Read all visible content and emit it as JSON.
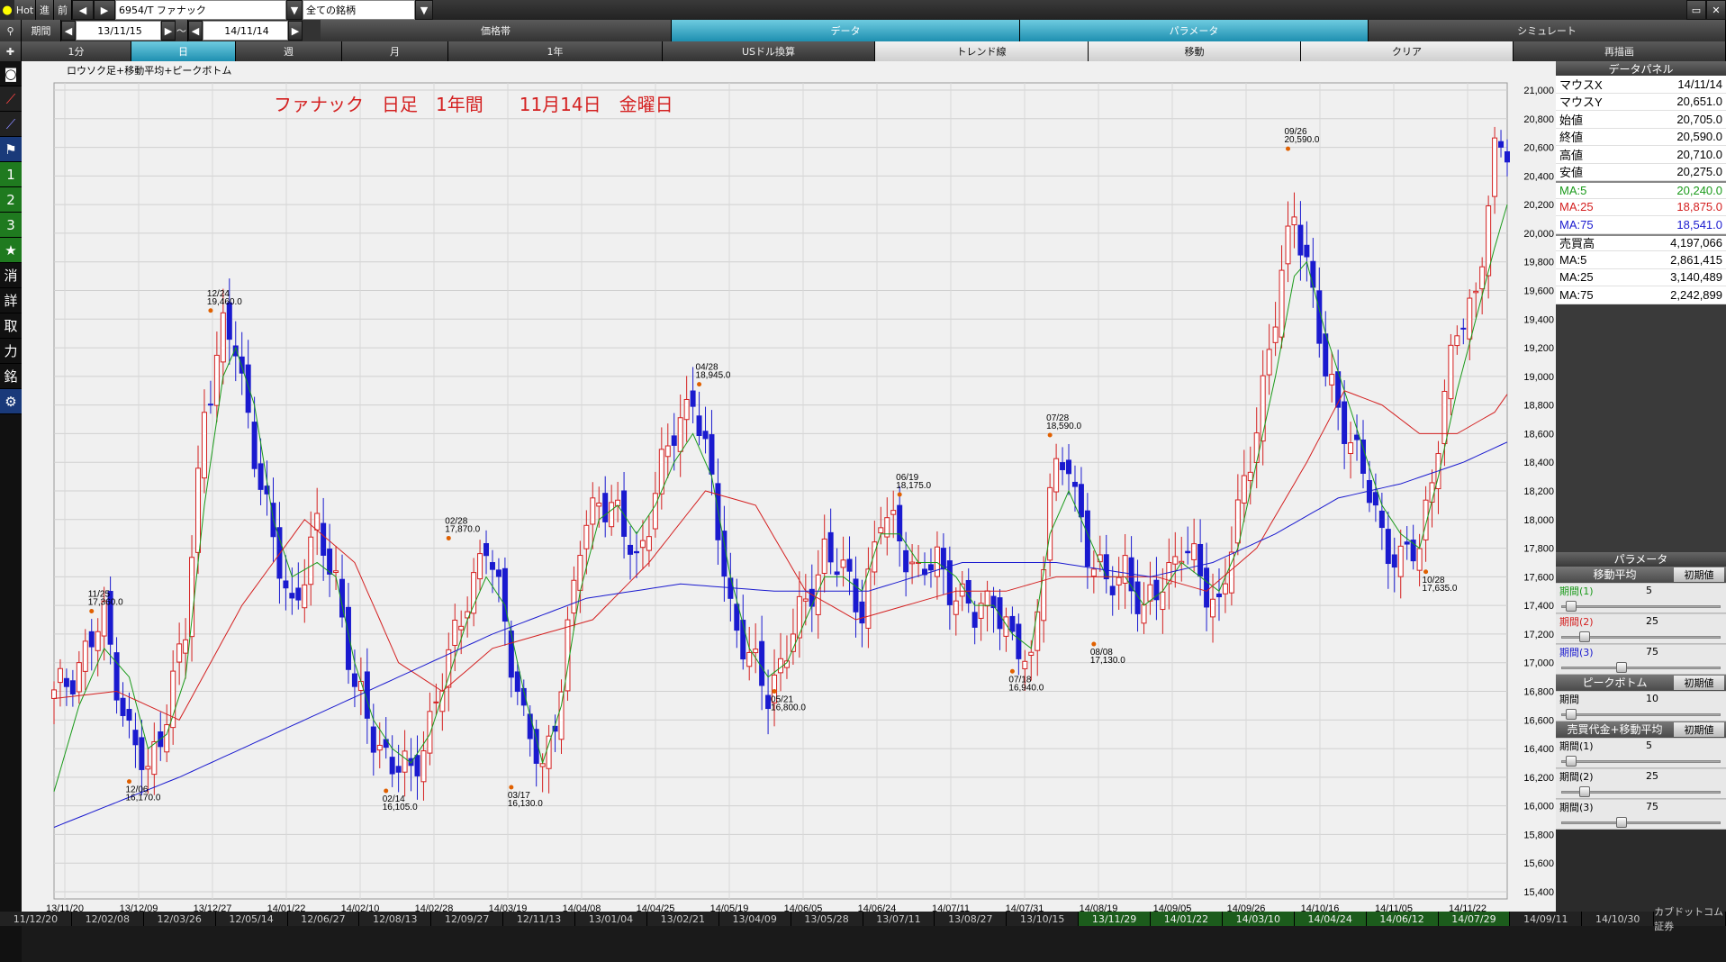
{
  "toolbar": {
    "hot": "Hot",
    "forward": "進",
    "back": "前",
    "symbol": "6954/T ファナック",
    "universe": "全ての銘柄",
    "period_label": "期間",
    "date_from": "13/11/15",
    "tilde": "～",
    "date_to": "14/11/14"
  },
  "top_tabs": [
    "価格帯",
    "データ",
    "パラメータ",
    "シミュレート"
  ],
  "range_tabs": [
    "1分",
    "日",
    "週",
    "月",
    "1年",
    "USドル換算",
    "トレンド線",
    "移動",
    "クリア",
    "再描画"
  ],
  "side_icons": [
    "search-icon",
    "plus-icon",
    "camera-icon",
    "line-chart-icon",
    "trend-icon",
    "flag-icon",
    "1",
    "2",
    "3",
    "★",
    "消",
    "詳",
    "取",
    "力",
    "銘",
    "gear-icon"
  ],
  "chart": {
    "caption": "ロウソク足+移動平均+ピークボトム",
    "headline": "ファナック　日足　1年間　　11月14日　金曜日",
    "y_ticks": [
      "21,000",
      "20,800",
      "20,600",
      "20,400",
      "20,200",
      "20,000",
      "19,800",
      "19,600",
      "19,400",
      "19,200",
      "19,000",
      "18,800",
      "18,600",
      "18,400",
      "18,200",
      "18,000",
      "17,800",
      "17,600",
      "17,400",
      "17,200",
      "17,000",
      "16,800",
      "16,600",
      "16,400",
      "16,200",
      "16,000",
      "15,800",
      "15,600",
      "15,400"
    ],
    "x_ticks": [
      "13/11/20",
      "13/12/09",
      "13/12/27",
      "14/01/22",
      "14/02/10",
      "14/02/28",
      "14/03/19",
      "14/04/08",
      "14/04/25",
      "14/05/19",
      "14/06/05",
      "14/06/24",
      "14/07/11",
      "14/07/31",
      "14/08/19",
      "14/09/05",
      "14/09/26",
      "14/10/16",
      "14/11/05",
      "14/11/22"
    ],
    "colors": {
      "up": "#d42020",
      "down": "#1a1acf",
      "ma5": "#1a9a1a",
      "ma25": "#d42020",
      "ma75": "#1a1acf",
      "peak": "#e06000"
    }
  },
  "chart_data": {
    "type": "candlestick",
    "ylim": [
      15400,
      21000
    ],
    "x_range": [
      "13/11/15",
      "14/11/14"
    ],
    "peaks_bottoms": [
      {
        "date": "11/25",
        "value": "17,360.0",
        "type": "peak"
      },
      {
        "date": "12/06",
        "value": "16,170.0",
        "type": "bottom"
      },
      {
        "date": "12/24",
        "value": "19,460.0",
        "type": "peak"
      },
      {
        "date": "02/14",
        "value": "16,105.0",
        "type": "bottom"
      },
      {
        "date": "02/28",
        "value": "17,870.0",
        "type": "peak"
      },
      {
        "date": "03/17",
        "value": "16,130.0",
        "type": "bottom"
      },
      {
        "date": "04/28",
        "value": "18,945.0",
        "type": "peak"
      },
      {
        "date": "05/21",
        "value": "16,800.0",
        "type": "bottom"
      },
      {
        "date": "06/19",
        "value": "18,175.0",
        "type": "peak"
      },
      {
        "date": "07/18",
        "value": "16,940.0",
        "type": "bottom"
      },
      {
        "date": "07/28",
        "value": "18,590.0",
        "type": "peak"
      },
      {
        "date": "08/08",
        "value": "17,130.0",
        "type": "bottom"
      },
      {
        "date": "09/26",
        "value": "20,590.0",
        "type": "peak"
      },
      {
        "date": "10/28",
        "value": "17,635.0",
        "type": "bottom"
      }
    ],
    "close_path": [
      [
        0,
        16750
      ],
      [
        4,
        17000
      ],
      [
        8,
        17300
      ],
      [
        12,
        16500
      ],
      [
        15,
        16200
      ],
      [
        18,
        16700
      ],
      [
        21,
        17200
      ],
      [
        24,
        18800
      ],
      [
        27,
        19300
      ],
      [
        29,
        19200
      ],
      [
        32,
        18500
      ],
      [
        35,
        17800
      ],
      [
        38,
        17400
      ],
      [
        42,
        17900
      ],
      [
        45,
        17600
      ],
      [
        48,
        16800
      ],
      [
        51,
        16500
      ],
      [
        54,
        16300
      ],
      [
        57,
        16200
      ],
      [
        60,
        16600
      ],
      [
        63,
        17000
      ],
      [
        66,
        17500
      ],
      [
        69,
        17800
      ],
      [
        72,
        17300
      ],
      [
        75,
        16600
      ],
      [
        78,
        16200
      ],
      [
        81,
        16900
      ],
      [
        84,
        17800
      ],
      [
        87,
        18200
      ],
      [
        90,
        18000
      ],
      [
        93,
        17700
      ],
      [
        96,
        18200
      ],
      [
        99,
        18600
      ],
      [
        102,
        18900
      ],
      [
        105,
        18200
      ],
      [
        108,
        17400
      ],
      [
        111,
        17000
      ],
      [
        114,
        16800
      ],
      [
        117,
        17100
      ],
      [
        120,
        17400
      ],
      [
        123,
        17800
      ],
      [
        126,
        17600
      ],
      [
        129,
        17400
      ],
      [
        132,
        18000
      ],
      [
        135,
        17900
      ],
      [
        138,
        17600
      ],
      [
        141,
        17700
      ],
      [
        144,
        17500
      ],
      [
        147,
        17300
      ],
      [
        150,
        17500
      ],
      [
        153,
        17100
      ],
      [
        156,
        17000
      ],
      [
        159,
        18200
      ],
      [
        162,
        18400
      ],
      [
        165,
        17800
      ],
      [
        168,
        17500
      ],
      [
        171,
        17700
      ],
      [
        174,
        17300
      ],
      [
        177,
        17600
      ],
      [
        180,
        17800
      ],
      [
        183,
        17600
      ],
      [
        186,
        17400
      ],
      [
        189,
        18000
      ],
      [
        192,
        18700
      ],
      [
        195,
        19400
      ],
      [
        198,
        20200
      ],
      [
        200,
        19800
      ],
      [
        203,
        19000
      ],
      [
        206,
        18700
      ],
      [
        209,
        18300
      ],
      [
        212,
        17900
      ],
      [
        215,
        17700
      ],
      [
        218,
        17800
      ],
      [
        221,
        18600
      ],
      [
        224,
        19300
      ],
      [
        227,
        19600
      ],
      [
        230,
        20500
      ],
      [
        232,
        20600
      ]
    ],
    "ma5_path": [
      [
        0,
        16100
      ],
      [
        4,
        16700
      ],
      [
        8,
        17100
      ],
      [
        12,
        16900
      ],
      [
        15,
        16400
      ],
      [
        18,
        16500
      ],
      [
        21,
        16900
      ],
      [
        24,
        18100
      ],
      [
        27,
        19000
      ],
      [
        29,
        19200
      ],
      [
        32,
        18800
      ],
      [
        35,
        18000
      ],
      [
        38,
        17600
      ],
      [
        42,
        17700
      ],
      [
        45,
        17600
      ],
      [
        48,
        17000
      ],
      [
        51,
        16600
      ],
      [
        54,
        16400
      ],
      [
        57,
        16300
      ],
      [
        60,
        16500
      ],
      [
        63,
        16900
      ],
      [
        66,
        17300
      ],
      [
        69,
        17600
      ],
      [
        72,
        17400
      ],
      [
        75,
        16800
      ],
      [
        78,
        16300
      ],
      [
        81,
        16700
      ],
      [
        84,
        17500
      ],
      [
        87,
        18000
      ],
      [
        90,
        18100
      ],
      [
        93,
        17900
      ],
      [
        96,
        18100
      ],
      [
        99,
        18400
      ],
      [
        102,
        18600
      ],
      [
        105,
        18300
      ],
      [
        108,
        17600
      ],
      [
        111,
        17100
      ],
      [
        114,
        16900
      ],
      [
        117,
        17000
      ],
      [
        120,
        17300
      ],
      [
        123,
        17600
      ],
      [
        126,
        17600
      ],
      [
        129,
        17500
      ],
      [
        132,
        17900
      ],
      [
        135,
        17900
      ],
      [
        138,
        17700
      ],
      [
        141,
        17700
      ],
      [
        144,
        17600
      ],
      [
        147,
        17400
      ],
      [
        150,
        17400
      ],
      [
        153,
        17200
      ],
      [
        156,
        17100
      ],
      [
        159,
        17900
      ],
      [
        162,
        18200
      ],
      [
        165,
        17900
      ],
      [
        168,
        17600
      ],
      [
        171,
        17600
      ],
      [
        174,
        17400
      ],
      [
        177,
        17500
      ],
      [
        180,
        17700
      ],
      [
        183,
        17600
      ],
      [
        186,
        17500
      ],
      [
        189,
        17800
      ],
      [
        192,
        18400
      ],
      [
        195,
        19000
      ],
      [
        198,
        19700
      ],
      [
        200,
        19800
      ],
      [
        203,
        19300
      ],
      [
        206,
        18900
      ],
      [
        209,
        18500
      ],
      [
        212,
        18100
      ],
      [
        215,
        17900
      ],
      [
        218,
        17800
      ],
      [
        221,
        18300
      ],
      [
        224,
        18900
      ],
      [
        227,
        19400
      ],
      [
        230,
        19900
      ],
      [
        232,
        20200
      ]
    ],
    "ma25_path": [
      [
        0,
        16750
      ],
      [
        10,
        16800
      ],
      [
        20,
        16600
      ],
      [
        30,
        17400
      ],
      [
        40,
        18000
      ],
      [
        48,
        17700
      ],
      [
        55,
        17000
      ],
      [
        62,
        16800
      ],
      [
        70,
        17100
      ],
      [
        78,
        17200
      ],
      [
        86,
        17300
      ],
      [
        95,
        17700
      ],
      [
        104,
        18200
      ],
      [
        112,
        18100
      ],
      [
        120,
        17500
      ],
      [
        128,
        17300
      ],
      [
        136,
        17400
      ],
      [
        144,
        17500
      ],
      [
        152,
        17500
      ],
      [
        160,
        17600
      ],
      [
        168,
        17600
      ],
      [
        176,
        17600
      ],
      [
        184,
        17500
      ],
      [
        192,
        17800
      ],
      [
        200,
        18400
      ],
      [
        206,
        18900
      ],
      [
        212,
        18800
      ],
      [
        218,
        18600
      ],
      [
        224,
        18600
      ],
      [
        230,
        18750
      ],
      [
        232,
        18875
      ]
    ],
    "ma75_path": [
      [
        0,
        15850
      ],
      [
        20,
        16200
      ],
      [
        40,
        16600
      ],
      [
        55,
        16900
      ],
      [
        70,
        17200
      ],
      [
        85,
        17450
      ],
      [
        100,
        17550
      ],
      [
        115,
        17500
      ],
      [
        130,
        17500
      ],
      [
        145,
        17700
      ],
      [
        160,
        17700
      ],
      [
        175,
        17600
      ],
      [
        185,
        17700
      ],
      [
        195,
        17900
      ],
      [
        205,
        18150
      ],
      [
        215,
        18250
      ],
      [
        225,
        18400
      ],
      [
        232,
        18541
      ]
    ]
  },
  "data_panel": {
    "title": "データパネル",
    "rows": [
      {
        "label": "マウスX",
        "value": "14/11/14",
        "color": "#000"
      },
      {
        "label": "マウスY",
        "value": "20,651.0",
        "color": "#000"
      },
      {
        "label": "始値",
        "value": "20,705.0",
        "color": "#000"
      },
      {
        "label": "終値",
        "value": "20,590.0",
        "color": "#000"
      },
      {
        "label": "高値",
        "value": "20,710.0",
        "color": "#000"
      },
      {
        "label": "安値",
        "value": "20,275.0",
        "color": "#000"
      },
      {
        "label": "MA:5",
        "value": "20,240.0",
        "color": "#1a9a1a"
      },
      {
        "label": "MA:25",
        "value": "18,875.0",
        "color": "#d42020"
      },
      {
        "label": "MA:75",
        "value": "18,541.0",
        "color": "#1a1acf"
      },
      {
        "label": "売買高",
        "value": "4,197,066",
        "color": "#000"
      },
      {
        "label": "MA:5",
        "value": "2,861,415",
        "color": "#000"
      },
      {
        "label": "MA:25",
        "value": "3,140,489",
        "color": "#000"
      },
      {
        "label": "MA:75",
        "value": "2,242,899",
        "color": "#000"
      }
    ]
  },
  "params": {
    "title": "パラメータ",
    "reset": "初期値",
    "sections": [
      {
        "title": "移動平均",
        "rows": [
          {
            "label": "期間(1)",
            "value": "5",
            "color": "#1a9a1a",
            "level": 0.03
          },
          {
            "label": "期間(2)",
            "value": "25",
            "color": "#d42020",
            "level": 0.12
          },
          {
            "label": "期間(3)",
            "value": "75",
            "color": "#1a1acf",
            "level": 0.37
          }
        ]
      },
      {
        "title": "ピークボトム",
        "rows": [
          {
            "label": "期間",
            "value": "10",
            "color": "#000",
            "level": 0.03
          }
        ]
      },
      {
        "title": "売買代金+移動平均",
        "rows": [
          {
            "label": "期間(1)",
            "value": "5",
            "color": "#000",
            "level": 0.03
          },
          {
            "label": "期間(2)",
            "value": "25",
            "color": "#000",
            "level": 0.12
          },
          {
            "label": "期間(3)",
            "value": "75",
            "color": "#000",
            "level": 0.37
          }
        ]
      }
    ]
  },
  "bottom_dates": [
    "11/12/20",
    "12/02/08",
    "12/03/26",
    "12/05/14",
    "12/06/27",
    "12/08/13",
    "12/09/27",
    "12/11/13",
    "13/01/04",
    "13/02/21",
    "13/04/09",
    "13/05/28",
    "13/07/11",
    "13/08/27",
    "13/10/15",
    "13/11/29",
    "14/01/22",
    "14/03/10",
    "14/04/24",
    "14/06/12",
    "14/07/29",
    "14/09/11",
    "14/10/30",
    "カブドットコム証券"
  ]
}
